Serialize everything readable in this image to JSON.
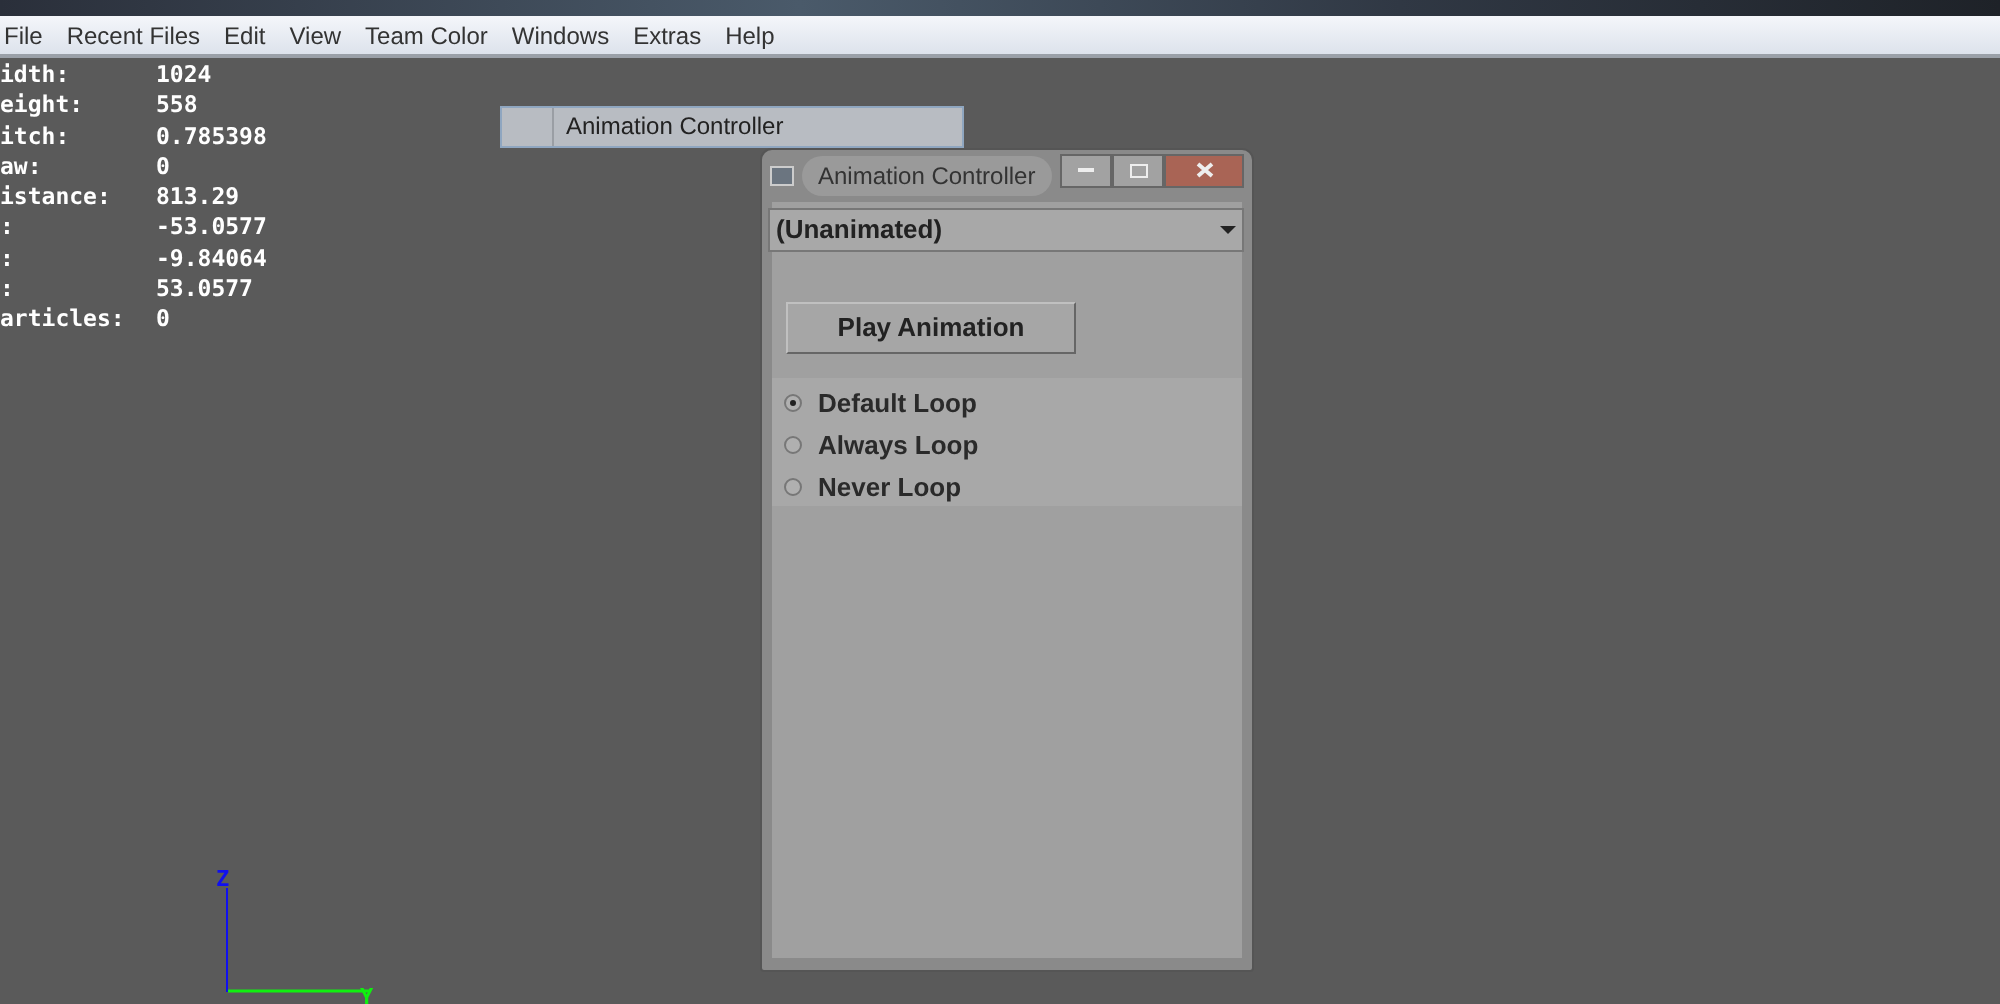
{
  "menu_bar": [
    {
      "label": "File"
    },
    {
      "label": "Recent Files"
    },
    {
      "label": "Edit"
    },
    {
      "label": "View"
    },
    {
      "label": "Team Color"
    },
    {
      "label": "Windows"
    },
    {
      "label": "Extras"
    },
    {
      "label": "Help"
    }
  ],
  "stats": [
    {
      "label": "idth:",
      "value": "1024"
    },
    {
      "label": "eight:",
      "value": "558"
    },
    {
      "label": "itch:",
      "value": "0.785398"
    },
    {
      "label": "aw:",
      "value": "0"
    },
    {
      "label": "istance:",
      "value": "813.29"
    },
    {
      "label": ":",
      "value": "-53.0577"
    },
    {
      "label": ":",
      "value": "-9.84064"
    },
    {
      "label": ":",
      "value": "53.0577"
    },
    {
      "label": "articles:",
      "value": "0"
    }
  ],
  "popup_menu": {
    "items": [
      {
        "label": "Animation Controller"
      }
    ]
  },
  "window": {
    "title": "Animation Controller",
    "dropdown": {
      "value": "(Unanimated)"
    },
    "play_button": "Play Animation",
    "loop_options": [
      {
        "label": "Default Loop",
        "selected": true
      },
      {
        "label": "Always Loop",
        "selected": false
      },
      {
        "label": "Never Loop",
        "selected": false
      }
    ]
  },
  "axes": {
    "vertical": "Z",
    "horizontal": "Y"
  }
}
